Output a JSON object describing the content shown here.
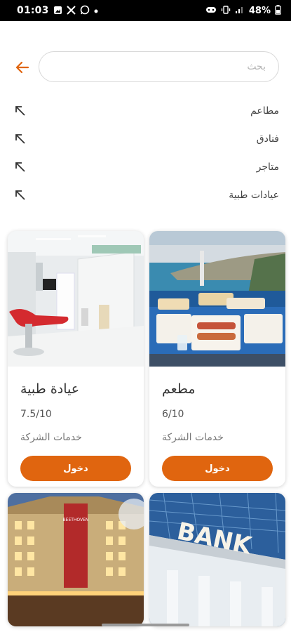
{
  "status_bar": {
    "time": "01:03",
    "battery": "48%",
    "left_icons": [
      "gallery-icon",
      "x-icon",
      "whatsapp-icon",
      "dot-icon"
    ],
    "right_icons": [
      "game-icon",
      "vibrate-icon",
      "signal-icon",
      "battery-icon"
    ]
  },
  "search": {
    "placeholder": "بحث",
    "value": ""
  },
  "suggestions": [
    {
      "label": "مطاعم"
    },
    {
      "label": "فنادق"
    },
    {
      "label": "متاجر"
    },
    {
      "label": "عيادات طبية"
    }
  ],
  "cards": [
    {
      "title": "مطعم",
      "rating": "6/10",
      "category": "خدمات الشركة",
      "button": "دخول"
    },
    {
      "title": "عيادة طبية",
      "rating": "7.5/10",
      "category": "خدمات الشركة",
      "button": "دخول"
    },
    {
      "sign": "BANK"
    },
    {
      "sign": "BEETHOVEN"
    }
  ],
  "colors": {
    "accent": "#e0650f",
    "status_bar": "#000000"
  }
}
